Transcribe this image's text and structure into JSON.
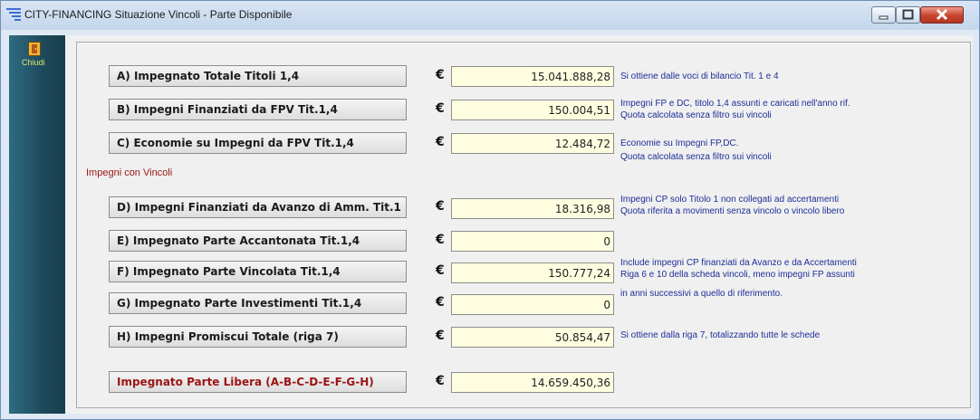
{
  "window": {
    "title": "CITY-FINANCING  Situazione Vincoli - Parte Disponibile",
    "exit_label": "Chiudi"
  },
  "section_label": "Impegni con Vincoli",
  "rows": [
    {
      "label": "A) Impegnato Totale Titoli 1,4",
      "currency": "€",
      "value": "15.041.888,28"
    },
    {
      "label": "B) Impegni Finanziati da FPV Tit.1,4",
      "currency": "€",
      "value": "150.004,51"
    },
    {
      "label": "C) Economie su Impegni da FPV Tit.1,4",
      "currency": "€",
      "value": "12.484,72"
    },
    {
      "label": "D) Impegni Finanziati da Avanzo di Amm. Tit.1",
      "currency": "€",
      "value": "18.316,98"
    },
    {
      "label": "E) Impegnato Parte Accantonata Tit.1,4",
      "currency": "€",
      "value": "0"
    },
    {
      "label": "F) Impegnato Parte Vincolata Tit.1,4",
      "currency": "€",
      "value": "150.777,24"
    },
    {
      "label": "G) Impegnato Parte Investimenti Tit.1,4",
      "currency": "€",
      "value": "0"
    },
    {
      "label": "H) Impegni Promiscui Totale (riga 7)",
      "currency": "€",
      "value": "50.854,47"
    },
    {
      "label": "Impegnato Parte Libera (A-B-C-D-E-F-G-H)",
      "currency": "€",
      "value": "14.659.450,36"
    }
  ],
  "notes": {
    "a": "Si ottiene dalle voci di bilancio Tit. 1 e 4",
    "b1": "Impegni FP e DC, titolo 1,4 assunti e caricati nell'anno rif.",
    "b2": "Quota calcolata senza filtro sui vincoli",
    "c1": "Economie su Impegni  FP,DC.",
    "c2": "Quota calcolata senza filtro sui vincoli",
    "d1": "Impegni CP solo Titolo 1 non collegati ad accertamenti",
    "d2": "Quota riferita a movimenti senza vincolo o vincolo libero",
    "f1": "Include impegni CP finanziati da Avanzo e da Accertamenti",
    "f2": "Riga 6 e 10 della scheda vincoli, meno impegni FP assunti",
    "f3": "in anni successivi a quello di riferimento.",
    "h": "Si ottiene dalla riga 7, totalizzando tutte le schede"
  },
  "colors": {
    "total_label": "#9b1414",
    "note_text": "#1d2e97",
    "value_field_bg": "#fffde0"
  }
}
